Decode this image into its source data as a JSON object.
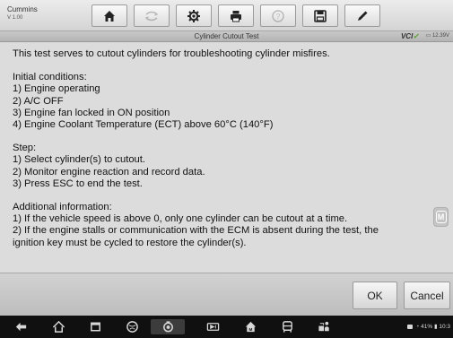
{
  "brand": {
    "name": "Cummins",
    "version": "V 1.00"
  },
  "toolbar": {
    "buttons": [
      {
        "icon": "home-icon"
      },
      {
        "icon": "vehicle-swap-icon",
        "disabled": true
      },
      {
        "icon": "settings-gear-icon"
      },
      {
        "icon": "print-icon"
      },
      {
        "icon": "help-icon",
        "disabled": true
      },
      {
        "icon": "save-icon"
      },
      {
        "icon": "edit-pen-icon"
      }
    ]
  },
  "titlebar": {
    "title": "Cylinder Cutout Test",
    "vci": "VCI",
    "vci_check": "✓",
    "battery": "12.39V"
  },
  "content": {
    "intro": "This test serves to cutout cylinders for troubleshooting cylinder misfires.",
    "conditions_heading": "Initial conditions:",
    "conditions": [
      "1) Engine operating",
      "2) A/C OFF",
      "3) Engine fan locked in ON position",
      "4) Engine Coolant Temperature (ECT) above 60°C (140°F)"
    ],
    "steps_heading": "Step:",
    "steps": [
      "1) Select cylinder(s) to cutout.",
      "2) Monitor engine reaction and record data.",
      "3) Press ESC to end the test."
    ],
    "info_heading": "Additional information:",
    "info": [
      "1) If the vehicle speed is above 0, only one cylinder can be cutout at a time.",
      "2) If the engine stalls or communication with the ECM is absent during the test, the",
      "ignition key must be cycled to restore the cylinder(s)."
    ],
    "side_badge": "M"
  },
  "actions": {
    "ok": "OK",
    "cancel": "Cancel"
  },
  "status": {
    "battery": "41%",
    "time": "10:3"
  },
  "colors": {
    "vci_check": "#4a9c1a",
    "background": "#dcdcdc",
    "navbar": "#101010"
  }
}
